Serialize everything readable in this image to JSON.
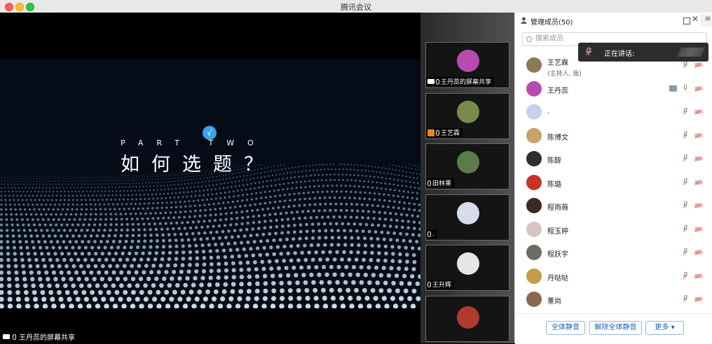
{
  "window": {
    "title": "腾讯会议"
  },
  "main": {
    "slide": {
      "badge": "√",
      "part": "PART TWO",
      "heading": "如何选题？"
    },
    "share_label": "王丹蕊的屏幕共享"
  },
  "thumbnails": [
    {
      "name": "王丹蕊的屏幕共享",
      "kind": "share",
      "avatar_color": "#b84bb0"
    },
    {
      "name": "王艺霖",
      "kind": "host",
      "avatar_color": "#7a8a4e"
    },
    {
      "name": "田林果",
      "kind": "muted",
      "avatar_color": "#5b7b4a"
    },
    {
      "name": ".",
      "kind": "muted",
      "avatar_color": "#d6dcee"
    },
    {
      "name": "王升辉",
      "kind": "muted",
      "avatar_color": "#e6e6e6"
    }
  ],
  "panel": {
    "title": "管理成员(50)",
    "search_placeholder": "搜索成员",
    "speaking_tooltip": "正在讲话:",
    "members": [
      {
        "name": "王艺霖",
        "sub": "(主持人, 我)",
        "avatar_color": "#8a7a55",
        "sharing": false
      },
      {
        "name": "王丹蕊",
        "sub": "",
        "avatar_color": "#b84bb0",
        "sharing": true
      },
      {
        "name": ".",
        "sub": "",
        "avatar_color": "#c8d0ea",
        "sharing": false
      },
      {
        "name": "陈博文",
        "sub": "",
        "avatar_color": "#c7a36a",
        "sharing": false
      },
      {
        "name": "陈醇",
        "sub": "",
        "avatar_color": "#2f2f2f",
        "sharing": false
      },
      {
        "name": "陈璐",
        "sub": "",
        "avatar_color": "#c83228",
        "sharing": false
      },
      {
        "name": "程雨薇",
        "sub": "",
        "avatar_color": "#3a2a22",
        "sharing": false
      },
      {
        "name": "程玉婷",
        "sub": "",
        "avatar_color": "#d9c5bf",
        "sharing": false
      },
      {
        "name": "程跃宇",
        "sub": "",
        "avatar_color": "#6e6a66",
        "sharing": false
      },
      {
        "name": "丹哒哒",
        "sub": "",
        "avatar_color": "#c79a4a",
        "sharing": false
      },
      {
        "name": "董尚",
        "sub": "",
        "avatar_color": "#8a6a4e",
        "sharing": false
      }
    ],
    "buttons": {
      "mute_all": "全体静音",
      "unmute_all": "解除全体静音",
      "more": "更多 ▾"
    }
  },
  "colors": {
    "accent": "#1a62b5",
    "mic_muted": "#e06b6b",
    "slide_bg": "#050c18"
  }
}
